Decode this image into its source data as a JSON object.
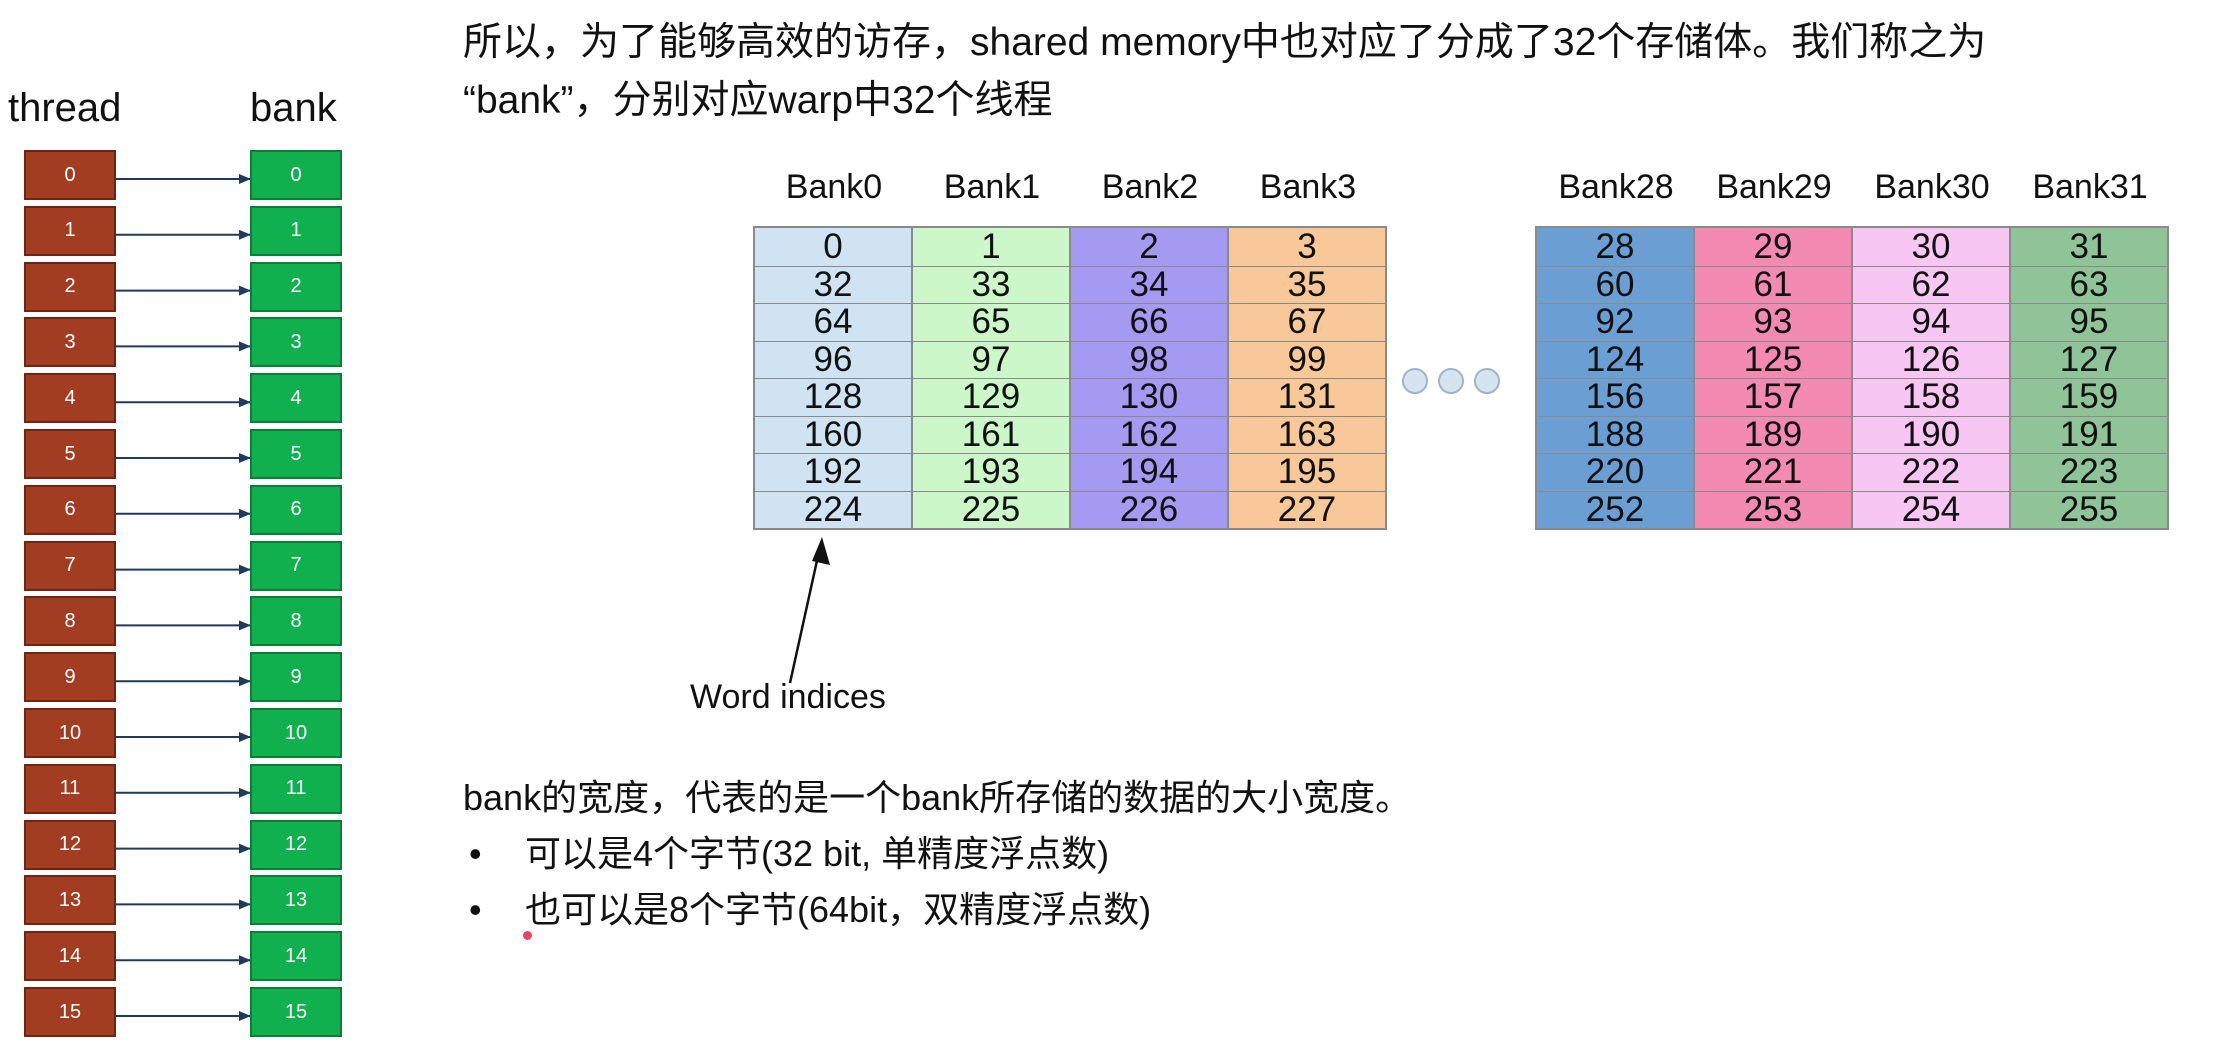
{
  "intro": {
    "line1": "所以，为了能够高效的访存，shared memory中也对应了分成了32个存储体。我们称之为",
    "line2": "“bank”，分别对应warp中32个线程"
  },
  "thread_column": {
    "header": "thread",
    "items": [
      "0",
      "1",
      "2",
      "3",
      "4",
      "5",
      "6",
      "7",
      "8",
      "9",
      "10",
      "11",
      "12",
      "13",
      "14",
      "15"
    ]
  },
  "bank_column": {
    "header": "bank",
    "items": [
      "0",
      "1",
      "2",
      "3",
      "4",
      "5",
      "6",
      "7",
      "8",
      "9",
      "10",
      "11",
      "12",
      "13",
      "14",
      "15"
    ]
  },
  "bank_table": {
    "left_group": [
      {
        "name": "Bank0",
        "color": "#cfe3f3",
        "words": [
          "0",
          "32",
          "64",
          "96",
          "128",
          "160",
          "192",
          "224"
        ]
      },
      {
        "name": "Bank1",
        "color": "#ccf7c8",
        "words": [
          "1",
          "33",
          "65",
          "97",
          "129",
          "161",
          "193",
          "225"
        ]
      },
      {
        "name": "Bank2",
        "color": "#a49af2",
        "words": [
          "2",
          "34",
          "66",
          "98",
          "130",
          "162",
          "194",
          "226"
        ]
      },
      {
        "name": "Bank3",
        "color": "#f8c898",
        "words": [
          "3",
          "35",
          "67",
          "99",
          "131",
          "163",
          "195",
          "227"
        ]
      }
    ],
    "right_group": [
      {
        "name": "Bank28",
        "color": "#6b9fd4",
        "words": [
          "28",
          "60",
          "92",
          "124",
          "156",
          "188",
          "220",
          "252"
        ]
      },
      {
        "name": "Bank29",
        "color": "#f28ab2",
        "words": [
          "29",
          "61",
          "93",
          "125",
          "157",
          "189",
          "221",
          "253"
        ]
      },
      {
        "name": "Bank30",
        "color": "#f7c6f2",
        "words": [
          "30",
          "62",
          "94",
          "126",
          "158",
          "190",
          "222",
          "254"
        ]
      },
      {
        "name": "Bank31",
        "color": "#8fc498",
        "words": [
          "31",
          "63",
          "95",
          "127",
          "159",
          "191",
          "223",
          "255"
        ]
      }
    ],
    "annotation": "Word indices"
  },
  "bank_width": {
    "heading": "bank的宽度，代表的是一个bank所存储的数据的大小宽度。",
    "bullet_symbol": "•",
    "bullets": [
      "可以是4个字节(32 bit,  单精度浮点数)",
      "也可以是8个字节(64bit，双精度浮点数)"
    ]
  },
  "colors": {
    "thread_cell": "#a33d22",
    "bank_cell": "#10b04e",
    "arrow": "#1f3a5a"
  }
}
